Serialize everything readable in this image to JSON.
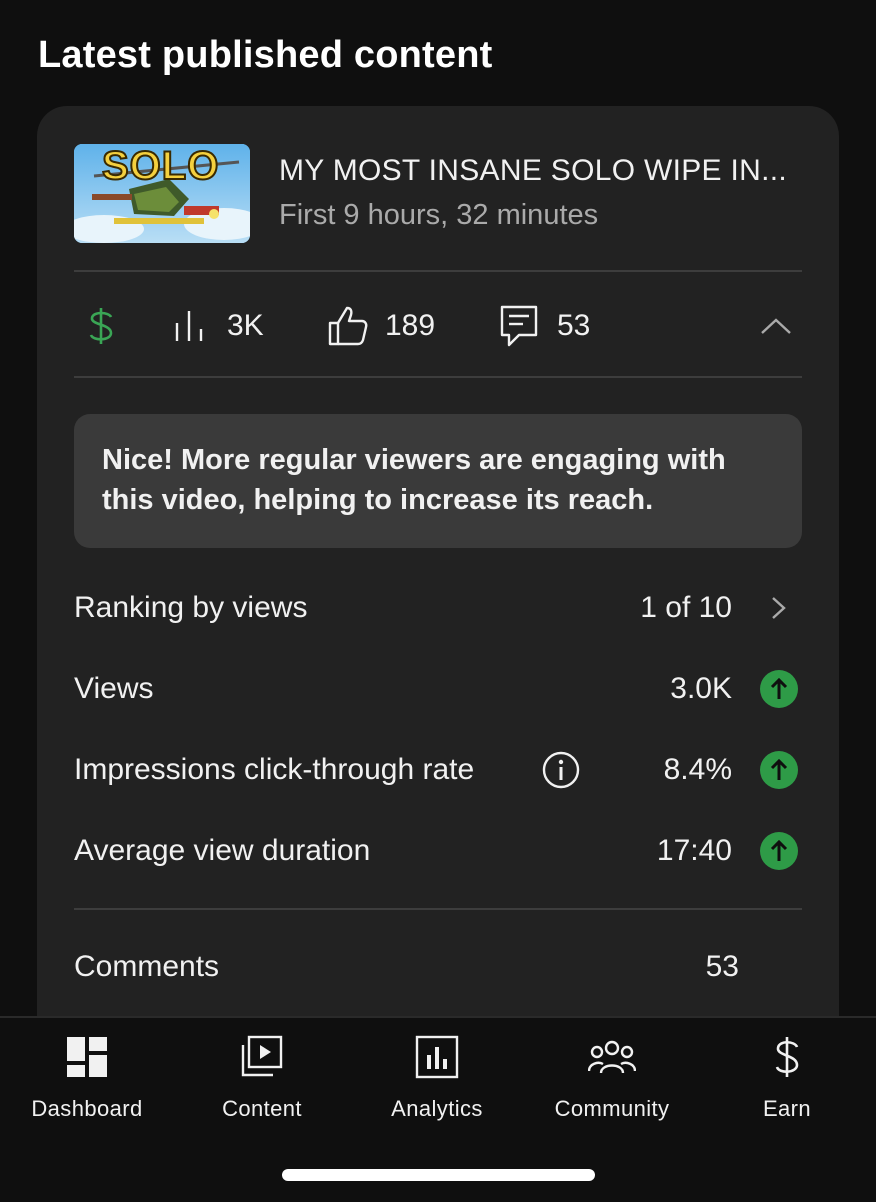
{
  "section_title": "Latest published content",
  "video": {
    "thumbnail_text": "SOLO",
    "title": "MY MOST INSANE SOLO WIPE IN...",
    "subtitle": "First 9 hours, 32 minutes"
  },
  "stats": {
    "monetization_icon": "dollar-icon",
    "views": "3K",
    "likes": "189",
    "comments": "53"
  },
  "tip_text": "Nice! More regular viewers are engaging with this video, helping to increase its reach.",
  "metrics": [
    {
      "label": "Ranking by views",
      "value": "1 of 10",
      "trail": "chevron-right-icon"
    },
    {
      "label": "Views",
      "value": "3.0K",
      "trail": "arrow-up-icon"
    },
    {
      "label": "Impressions click-through rate",
      "value": "8.4%",
      "trail": "arrow-up-icon"
    },
    {
      "label": "Average view duration",
      "value": "17:40",
      "trail": "arrow-up-icon"
    }
  ],
  "comments": {
    "label": "Comments",
    "count": "53"
  },
  "nav": [
    {
      "label": "Dashboard",
      "icon": "dashboard-icon"
    },
    {
      "label": "Content",
      "icon": "content-icon"
    },
    {
      "label": "Analytics",
      "icon": "analytics-icon"
    },
    {
      "label": "Community",
      "icon": "community-icon"
    },
    {
      "label": "Earn",
      "icon": "dollar-icon"
    }
  ],
  "colors": {
    "background": "#0f0f0f",
    "card": "#222222",
    "tip_box": "#3a3a3a",
    "accent_green": "#2e9b47",
    "muted_text": "#aaaaaa"
  }
}
